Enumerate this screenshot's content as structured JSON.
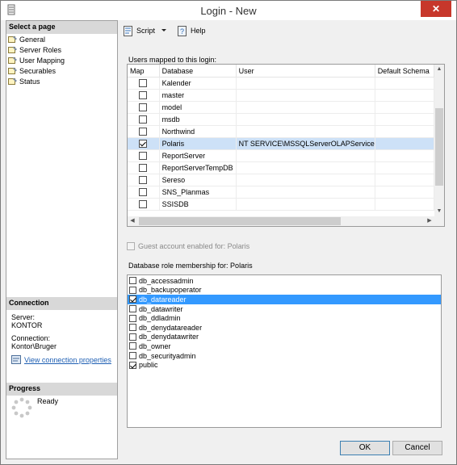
{
  "window": {
    "title": "Login - New",
    "close_glyph": "✕"
  },
  "left_pane": {
    "select_page_header": "Select a page",
    "pages": [
      {
        "label": "General",
        "icon": "wrench-page-icon"
      },
      {
        "label": "Server Roles",
        "icon": "wrench-page-icon"
      },
      {
        "label": "User Mapping",
        "icon": "wrench-page-icon"
      },
      {
        "label": "Securables",
        "icon": "wrench-page-icon"
      },
      {
        "label": "Status",
        "icon": "wrench-page-icon"
      }
    ],
    "connection_header": "Connection",
    "server_label": "Server:",
    "server_value": "KONTOR",
    "connection_label": "Connection:",
    "connection_value": "Kontor\\Bruger",
    "view_connection_link": "View connection properties",
    "progress_header": "Progress",
    "progress_status": "Ready"
  },
  "toolbar": {
    "script_label": "Script",
    "help_label": "Help"
  },
  "users_mapped": {
    "label": "Users mapped to this login:",
    "columns": [
      "Map",
      "Database",
      "User",
      "Default Schema"
    ],
    "rows": [
      {
        "map": false,
        "database": "Kalender",
        "user": "",
        "schema": ""
      },
      {
        "map": false,
        "database": "master",
        "user": "",
        "schema": ""
      },
      {
        "map": false,
        "database": "model",
        "user": "",
        "schema": ""
      },
      {
        "map": false,
        "database": "msdb",
        "user": "",
        "schema": ""
      },
      {
        "map": false,
        "database": "Northwind",
        "user": "",
        "schema": ""
      },
      {
        "map": true,
        "database": "Polaris",
        "user": "NT SERVICE\\MSSQLServerOLAPService",
        "schema": "",
        "selected": true
      },
      {
        "map": false,
        "database": "ReportServer",
        "user": "",
        "schema": ""
      },
      {
        "map": false,
        "database": "ReportServerTempDB",
        "user": "",
        "schema": ""
      },
      {
        "map": false,
        "database": "Sereso",
        "user": "",
        "schema": ""
      },
      {
        "map": false,
        "database": "SNS_Planmas",
        "user": "",
        "schema": ""
      },
      {
        "map": false,
        "database": "SSISDB",
        "user": "",
        "schema": ""
      }
    ]
  },
  "guest_account_label": "Guest account enabled for: Polaris",
  "role_membership": {
    "label": "Database role membership for: Polaris",
    "roles": [
      {
        "name": "db_accessadmin",
        "checked": false
      },
      {
        "name": "db_backupoperator",
        "checked": false
      },
      {
        "name": "db_datareader",
        "checked": true,
        "selected": true
      },
      {
        "name": "db_datawriter",
        "checked": false
      },
      {
        "name": "db_ddladmin",
        "checked": false
      },
      {
        "name": "db_denydatareader",
        "checked": false
      },
      {
        "name": "db_denydatawriter",
        "checked": false
      },
      {
        "name": "db_owner",
        "checked": false
      },
      {
        "name": "db_securityadmin",
        "checked": false
      },
      {
        "name": "public",
        "checked": true
      }
    ]
  },
  "buttons": {
    "ok": "OK",
    "cancel": "Cancel"
  },
  "colors": {
    "selection_light": "#cde1f7",
    "selection_strong": "#3399ff",
    "close_red": "#c7372b",
    "link_blue": "#1e5fb3"
  }
}
